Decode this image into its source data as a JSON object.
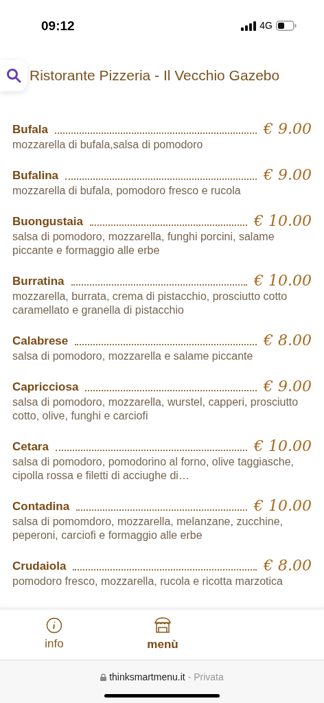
{
  "status_bar": {
    "time": "09:12",
    "network": "4G"
  },
  "header": {
    "title": "Ristorante Pizzeria - Il Vecchio Gazebo"
  },
  "menu_items": [
    {
      "name": "Bufala",
      "price": "€ 9.00",
      "description": "mozzarella di bufala,salsa di pomodoro"
    },
    {
      "name": "Bufalina",
      "price": "€ 9.00",
      "description": "mozzarella di bufala, pomodoro fresco e rucola"
    },
    {
      "name": "Buongustaia",
      "price": "€ 10.00",
      "description": "salsa di pomodoro, mozzarella, funghi porcini, salame piccante e formaggio alle erbe"
    },
    {
      "name": "Burratina",
      "price": "€ 10.00",
      "description": "mozzarella, burrata, crema di pistacchio, prosciutto cotto caramellato e granella di pistacchio"
    },
    {
      "name": "Calabrese",
      "price": "€ 8.00",
      "description": "salsa di pomodoro, mozzarella e salame piccante"
    },
    {
      "name": "Capricciosa",
      "price": "€ 9.00",
      "description": "salsa di pomodoro, mozzarella, wurstel, capperi, prosciutto cotto, olive, funghi e carciofi"
    },
    {
      "name": "Cetara",
      "price": "€ 10.00",
      "description": "salsa di pomodoro, pomodorino al forno, olive taggiasche, cipolla rossa e filetti di acciughe di…"
    },
    {
      "name": "Contadina",
      "price": "€ 10.00",
      "description": "salsa di pomomdoro, mozzarella, melanzane, zucchine, peperoni, carciofi e formaggio alle erbe"
    },
    {
      "name": "Crudaiola",
      "price": "€ 8.00",
      "description": "pomodoro fresco, mozzarella, rucola e ricotta marzotica"
    }
  ],
  "tab_bar": [
    {
      "kind": "info",
      "label": "info",
      "selected": false
    },
    {
      "kind": "store",
      "label": "menù",
      "selected": true
    }
  ],
  "address_bar": {
    "domain": "thinksmartmenu.it",
    "mode": "- Privata"
  }
}
